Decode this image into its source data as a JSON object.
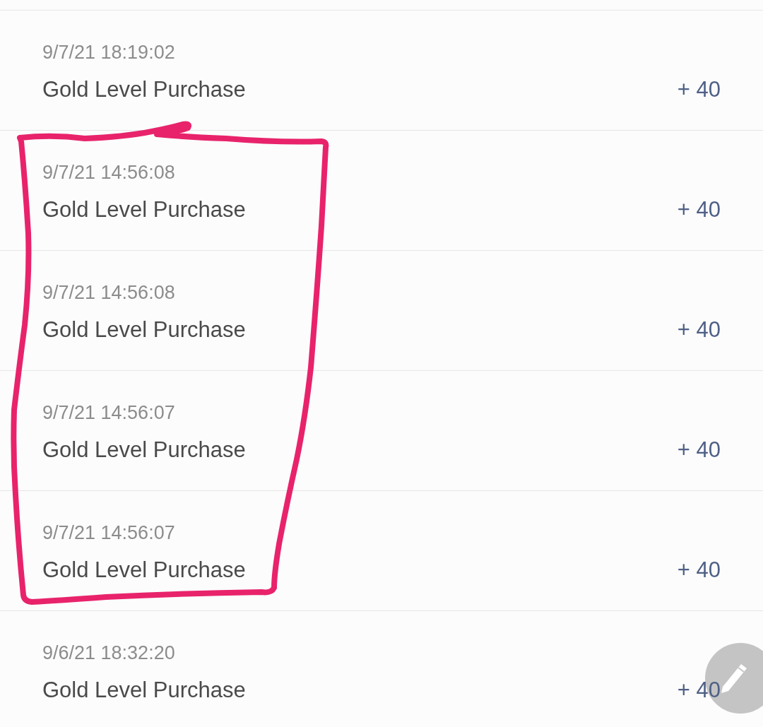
{
  "transactions": [
    {
      "timestamp": "9/7/21 18:19:02",
      "title": "Gold Level Purchase",
      "amount": "+ 40",
      "marked": false
    },
    {
      "timestamp": "9/7/21 14:56:08",
      "title": "Gold Level Purchase",
      "amount": "+ 40",
      "marked": true
    },
    {
      "timestamp": "9/7/21 14:56:08",
      "title": "Gold Level Purchase",
      "amount": "+ 40",
      "marked": true
    },
    {
      "timestamp": "9/7/21 14:56:07",
      "title": "Gold Level Purchase",
      "amount": "+ 40",
      "marked": true
    },
    {
      "timestamp": "9/7/21 14:56:07",
      "title": "Gold Level Purchase",
      "amount": "+ 40",
      "marked": true
    },
    {
      "timestamp": "9/6/21 18:32:20",
      "title": "Gold Level Purchase",
      "amount": "+ 40",
      "marked": false
    }
  ]
}
